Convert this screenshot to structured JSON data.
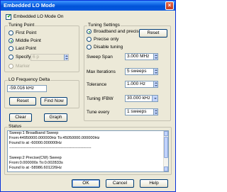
{
  "window": {
    "title": "Embedded LO Mode",
    "close_glyph": "×"
  },
  "embedded_on": {
    "label": "Embedded LO Mode On",
    "checked": true
  },
  "tuning_point": {
    "title": "Tuning Point",
    "first_point": "First Point",
    "middle_point": "Middle Point",
    "last_point": "Last Point",
    "specify": "Specify",
    "specify_value": "6 p",
    "marker": "Marker",
    "selected": "Middle Point"
  },
  "lo_delta": {
    "title": "LO Frequency Delta",
    "value": "-59.016 kHz",
    "reset_label": "Reset",
    "find_now_label": "Find Now"
  },
  "actions": {
    "clear_label": "Clear",
    "graph_label": "Graph"
  },
  "tuning_settings": {
    "title": "Tuning Settings",
    "broadband_precise": "Broadband and precise",
    "precise_only": "Precise only",
    "disable_tuning": "Disable tuning",
    "reset_label": "Reset",
    "selected": "Broadband and precise",
    "sweep_span_label": "Sweep Span",
    "sweep_span_value": "3.000 MHz",
    "max_iterations_label": "Max Iterations",
    "max_iterations_value": "5 sweeps",
    "tolerance_label": "Tolerance",
    "tolerance_value": "1.000 Hz",
    "tuning_ifbw_label": "Tuning IFBW",
    "tuning_ifbw_value": "30.000 kHz",
    "tune_every_label": "Tune every",
    "tune_every_value": "1 sweeps"
  },
  "status": {
    "title": "Status",
    "lines": [
      "Sweep:1 Broadband Sweep",
      "From:44950000.000000Hz To:45050000.000000Hz",
      "Found lo at  -60000.000000Hz",
      "--------------------------------------------------------------",
      "",
      "Sweep:2 Precise(CW) Sweep",
      "From:0.000000s To:0.002833s",
      "Found lo at  -58986.601226Hz"
    ]
  },
  "footer": {
    "ok_label": "OK",
    "cancel_label": "Cancel",
    "help_label": "Help"
  }
}
